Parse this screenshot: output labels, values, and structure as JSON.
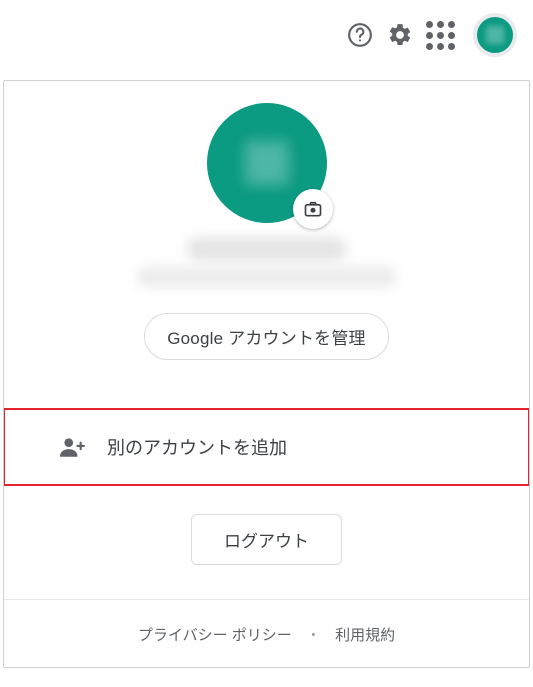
{
  "colors": {
    "avatar_bg": "#0b9a82",
    "highlight_border": "#e7232d"
  },
  "toolbar": {
    "help_icon": "help-icon",
    "settings_icon": "gear-icon",
    "apps_icon": "apps-grid-icon"
  },
  "profile": {
    "manage_account_label": "Google アカウントを管理",
    "add_account_label": "別のアカウントを追加",
    "logout_label": "ログアウト"
  },
  "footer": {
    "privacy_label": "プライバシー ポリシー",
    "separator": "・",
    "terms_label": "利用規約"
  }
}
